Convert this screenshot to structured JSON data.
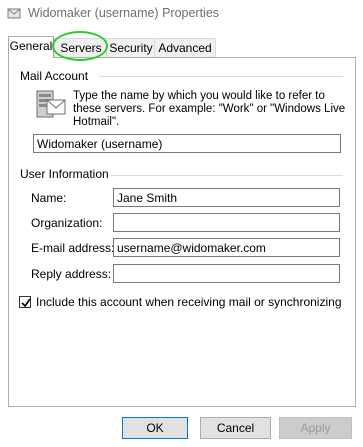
{
  "window": {
    "title": "Widomaker (username) Properties"
  },
  "tabs": [
    {
      "label": "General",
      "active": true
    },
    {
      "label": "Servers",
      "active": false
    },
    {
      "label": "Security",
      "active": false
    },
    {
      "label": "Advanced",
      "active": false
    }
  ],
  "mail_account": {
    "section_label": "Mail Account",
    "description": "Type the name by which you would like to refer to these servers.  For example: \"Work\" or \"Windows Live Hotmail\".",
    "account_name": "Widomaker (username)"
  },
  "user_info": {
    "section_label": "User Information",
    "name_label": "Name:",
    "name_value": "Jane Smith",
    "organization_label": "Organization:",
    "organization_value": "",
    "email_label": "E-mail address:",
    "email_value": "username@widomaker.com",
    "reply_label": "Reply address:",
    "reply_value": ""
  },
  "include_checkbox": {
    "label": "Include this account when receiving mail or synchronizing",
    "checked": true
  },
  "buttons": {
    "ok": "OK",
    "cancel": "Cancel",
    "apply": "Apply"
  },
  "colors": {
    "highlight": "#2ecc2e",
    "accent": "#0078d7"
  }
}
